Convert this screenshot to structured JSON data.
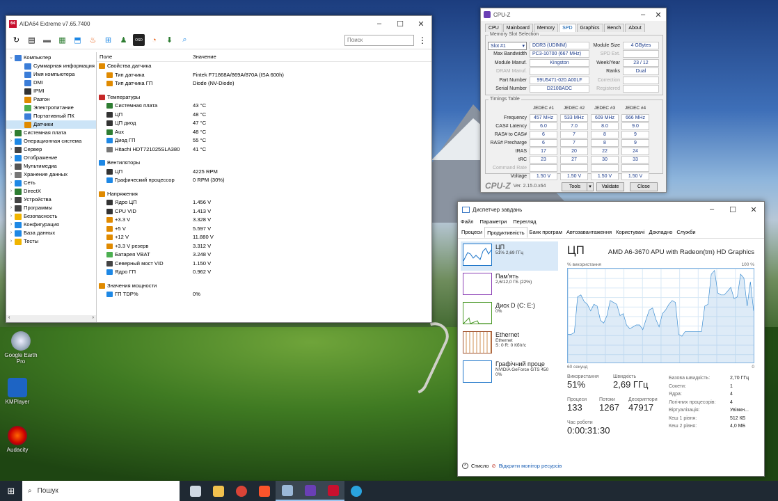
{
  "desktop": {
    "icons": [
      {
        "label": "Google Earth Pro"
      },
      {
        "label": "KMPlayer"
      },
      {
        "label": "Audacity"
      }
    ]
  },
  "aida": {
    "title": "AIDA64 Extreme v7.65.7400",
    "search_placeholder": "Поиск",
    "tree": [
      {
        "label": "Компьютер",
        "level": 0,
        "arrow": "⌄",
        "color": "#3b7dd8"
      },
      {
        "label": "Суммарная информация",
        "level": 1,
        "color": "#3b7dd8"
      },
      {
        "label": "Имя компьютера",
        "level": 1,
        "color": "#3b7dd8"
      },
      {
        "label": "DMI",
        "level": 1,
        "color": "#3b7dd8"
      },
      {
        "label": "IPMI",
        "level": 1,
        "color": "#333"
      },
      {
        "label": "Разгон",
        "level": 1,
        "color": "#e08a00"
      },
      {
        "label": "Электропитание",
        "level": 1,
        "color": "#4caf50"
      },
      {
        "label": "Портативный ПК",
        "level": 1,
        "color": "#3b7dd8"
      },
      {
        "label": "Датчики",
        "level": 1,
        "color": "#e08a00",
        "selected": true
      },
      {
        "label": "Системная плата",
        "level": 0,
        "arrow": "›",
        "color": "#2f7d32"
      },
      {
        "label": "Операционная система",
        "level": 0,
        "arrow": "›",
        "color": "#1e88e5"
      },
      {
        "label": "Сервер",
        "level": 0,
        "arrow": "›",
        "color": "#444"
      },
      {
        "label": "Отображение",
        "level": 0,
        "arrow": "›",
        "color": "#1e88e5"
      },
      {
        "label": "Мультимедиа",
        "level": 0,
        "arrow": "›",
        "color": "#555"
      },
      {
        "label": "Хранение данных",
        "level": 0,
        "arrow": "›",
        "color": "#777"
      },
      {
        "label": "Сеть",
        "level": 0,
        "arrow": "›",
        "color": "#1e88e5"
      },
      {
        "label": "DirectX",
        "level": 0,
        "arrow": "›",
        "color": "#2e7d32"
      },
      {
        "label": "Устройства",
        "level": 0,
        "arrow": "›",
        "color": "#444"
      },
      {
        "label": "Программы",
        "level": 0,
        "arrow": "›",
        "color": "#444"
      },
      {
        "label": "Безопасность",
        "level": 0,
        "arrow": "›",
        "color": "#f0b400"
      },
      {
        "label": "Конфигурация",
        "level": 0,
        "arrow": "›",
        "color": "#1e88e5"
      },
      {
        "label": "База данных",
        "level": 0,
        "arrow": "›",
        "color": "#1e88e5"
      },
      {
        "label": "Тесты",
        "level": 0,
        "arrow": "›",
        "color": "#f0b400"
      }
    ],
    "col_field": "Поле",
    "col_value": "Значение",
    "groups": [
      {
        "title": "Свойства датчика",
        "color": "#e08a00",
        "items": [
          {
            "name": "Тип датчика",
            "value": "Fintek F71868A/869A/870A  (ISA 600h)",
            "color": "#e08a00"
          },
          {
            "name": "Тип датчика ГП",
            "value": "Diode  (NV-Diode)",
            "color": "#e08a00"
          }
        ]
      },
      {
        "title": "Температуры",
        "color": "#c62828",
        "items": [
          {
            "name": "Системная плата",
            "value": "43 °C",
            "color": "#2e7d32"
          },
          {
            "name": "ЦП",
            "value": "48 °C",
            "color": "#333"
          },
          {
            "name": "ЦП диод",
            "value": "47 °C",
            "color": "#333"
          },
          {
            "name": "Aux",
            "value": "48 °C",
            "color": "#2e7d32"
          },
          {
            "name": "Диод ГП",
            "value": "55 °C",
            "color": "#1e88e5"
          },
          {
            "name": "Hitachi HDT721025SLA380",
            "value": "41 °C",
            "color": "#777"
          }
        ]
      },
      {
        "title": "Вентиляторы",
        "color": "#1e88e5",
        "items": [
          {
            "name": "ЦП",
            "value": "4225 RPM",
            "color": "#333"
          },
          {
            "name": "Графический процессор",
            "value": "0 RPM  (30%)",
            "color": "#1e88e5"
          }
        ]
      },
      {
        "title": "Напряжения",
        "color": "#e08a00",
        "items": [
          {
            "name": "Ядро ЦП",
            "value": "1.456 V",
            "color": "#333"
          },
          {
            "name": "CPU VID",
            "value": "1.413 V",
            "color": "#333"
          },
          {
            "name": "+3.3 V",
            "value": "3.328 V",
            "color": "#e08a00"
          },
          {
            "name": "+5 V",
            "value": "5.597 V",
            "color": "#e08a00"
          },
          {
            "name": "+12 V",
            "value": "11.880 V",
            "color": "#e08a00"
          },
          {
            "name": "+3.3 V резерв",
            "value": "3.312 V",
            "color": "#e08a00"
          },
          {
            "name": "Батарея VBAT",
            "value": "3.248 V",
            "color": "#4caf50"
          },
          {
            "name": "Северный мост VID",
            "value": "1.150 V",
            "color": "#444"
          },
          {
            "name": "Ядро ГП",
            "value": "0.962 V",
            "color": "#1e88e5"
          }
        ]
      },
      {
        "title": "Значения мощности",
        "color": "#e08a00",
        "items": [
          {
            "name": "ГП TDP%",
            "value": "0%",
            "color": "#1e88e5"
          }
        ]
      }
    ]
  },
  "cpuz": {
    "title": "CPU-Z",
    "tabs": [
      "CPU",
      "Mainboard",
      "Memory",
      "SPD",
      "Graphics",
      "Bench",
      "About"
    ],
    "active_tab": "SPD",
    "slot_legend": "Memory Slot Selection",
    "slot": "Slot #1",
    "module_type": "DDR3 (UDIMM)",
    "module_size_label": "Module Size",
    "module_size": "4 GBytes",
    "max_bw_label": "Max Bandwidth",
    "max_bw": "PC3-10700 (667 MHz)",
    "spd_ext_label": "SPD Ext.",
    "manuf_label": "Module Manuf.",
    "manuf": "Kingston",
    "weekyear_label": "Week/Year",
    "weekyear": "23 / 12",
    "dram_label": "DRAM Manuf.",
    "ranks_label": "Ranks",
    "ranks": "Dual",
    "part_label": "Part Number",
    "part": "99U5471-020.A00LF",
    "correction_label": "Correction",
    "serial_label": "Serial Number",
    "serial": "D210BADC",
    "registered_label": "Registered",
    "timings_legend": "Timings Table",
    "timing_cols": [
      "JEDEC #1",
      "JEDEC #2",
      "JEDEC #3",
      "JEDEC #4"
    ],
    "timing_rows": [
      {
        "label": "Frequency",
        "values": [
          "457 MHz",
          "533 MHz",
          "609 MHz",
          "666 MHz"
        ]
      },
      {
        "label": "CAS# Latency",
        "values": [
          "6.0",
          "7.0",
          "8.0",
          "9.0"
        ]
      },
      {
        "label": "RAS# to CAS#",
        "values": [
          "6",
          "7",
          "8",
          "9"
        ]
      },
      {
        "label": "RAS# Precharge",
        "values": [
          "6",
          "7",
          "8",
          "9"
        ]
      },
      {
        "label": "tRAS",
        "values": [
          "17",
          "20",
          "22",
          "24"
        ]
      },
      {
        "label": "tRC",
        "values": [
          "23",
          "27",
          "30",
          "33"
        ]
      },
      {
        "label": "Command Rate",
        "values": [
          "",
          "",
          "",
          ""
        ],
        "dim": true
      },
      {
        "label": "Voltage",
        "values": [
          "1.50 V",
          "1.50 V",
          "1.50 V",
          "1.50 V"
        ]
      }
    ],
    "logo": "CPU-Z",
    "version": "Ver. 2.15.0.x64",
    "tools_btn": "Tools",
    "validate_btn": "Validate",
    "close_btn": "Close"
  },
  "tm": {
    "title": "Диспетчер завдань",
    "menu": [
      "Файл",
      "Параметри",
      "Перегляд"
    ],
    "tabs": [
      "Процеси",
      "Продуктивність",
      "Банк програм",
      "Автозавантаження",
      "Користувачі",
      "Докладно",
      "Служби"
    ],
    "active_tab": "Продуктивність",
    "side": [
      {
        "name": "ЦП",
        "val1": "51% 2,69 ГГц",
        "val2": "",
        "color": "#1a73c8"
      },
      {
        "name": "Пам'ять",
        "val1": "2,6/12,0 ГБ (22%)",
        "val2": "",
        "color": "#8b3fb5"
      },
      {
        "name": "Диск D (C: E:)",
        "val1": "0%",
        "val2": "",
        "color": "#4c9a2a"
      },
      {
        "name": "Ethernet",
        "val1": "Ethernet",
        "val2": "S: 0 R: 0 Кбіт/с",
        "color": "#a0522d"
      },
      {
        "name": "Графічний проце",
        "val1": "NVIDIA GeForce GTS 450",
        "val2": "0%",
        "color": "#1a73c8"
      }
    ],
    "heading": "ЦП",
    "model": "AMD A6-3670 APU with Radeon(tm) HD Graphics",
    "graph_label": "% використання",
    "graph_max": "100 %",
    "graph_time": "60 секунд",
    "graph_min": "0",
    "cpu_usage_series": [
      0.3,
      0.3,
      0.32,
      0.7,
      0.72,
      0.65,
      0.62,
      0.55,
      0.62,
      0.6,
      0.45,
      0.42,
      0.5,
      0.66,
      0.64,
      0.62,
      0.5,
      0.52,
      0.4,
      0.36,
      0.38,
      0.4,
      0.4,
      0.35,
      0.46,
      0.56,
      0.58,
      0.46,
      0.38,
      0.52,
      0.56,
      0.62,
      0.66,
      0.64,
      0.3,
      0.28,
      0.33,
      0.33,
      0.33,
      0.33,
      0.33,
      0.33,
      0.6,
      0.62,
      0.94,
      0.98,
      0.74,
      0.72,
      0.72,
      0.76,
      0.8,
      0.68,
      0.7,
      0.94,
      0.9,
      0.6,
      0.86,
      0.55
    ],
    "usage_label": "Використання",
    "usage": "51%",
    "speed_label": "Швидкість",
    "speed": "2,69 ГГц",
    "proc_label": "Процеси",
    "proc": "133",
    "threads_label": "Потоки",
    "threads": "1267",
    "handles_label": "Дескриптори",
    "handles": "47917",
    "uptime_label": "Час роботи",
    "uptime": "0:00:31:30",
    "props": [
      {
        "k": "Базова швидкість:",
        "v": "2,70 ГГц"
      },
      {
        "k": "Сокети:",
        "v": "1"
      },
      {
        "k": "Ядра:",
        "v": "4"
      },
      {
        "k": "Логічних процесорів:",
        "v": "4"
      },
      {
        "k": "Віртуалізація:",
        "v": "Увімкн..."
      },
      {
        "k": "Кеш 1 рівня:",
        "v": "512 КБ"
      },
      {
        "k": "Кеш 2 рівня:",
        "v": "4,0 МБ"
      }
    ],
    "fewer": "Стисло",
    "monitor_link": "Відкрити монітор ресурсів"
  },
  "taskbar": {
    "search": "Пошук",
    "apps": [
      {
        "name": "taskview-icon",
        "color": "#cfd8e3"
      },
      {
        "name": "explorer-icon",
        "color": "#f2c14e"
      },
      {
        "name": "chrome-icon",
        "color": "#db4437"
      },
      {
        "name": "brave-icon",
        "color": "#fb542b"
      },
      {
        "name": "taskmanager-icon",
        "color": "#9bb8d8",
        "active": true
      },
      {
        "name": "cpuz-icon",
        "color": "#6a3fb5",
        "active": true
      },
      {
        "name": "aida64-icon",
        "color": "#c8102e",
        "active": true
      },
      {
        "name": "telegram-icon",
        "color": "#2aa3de"
      }
    ]
  }
}
